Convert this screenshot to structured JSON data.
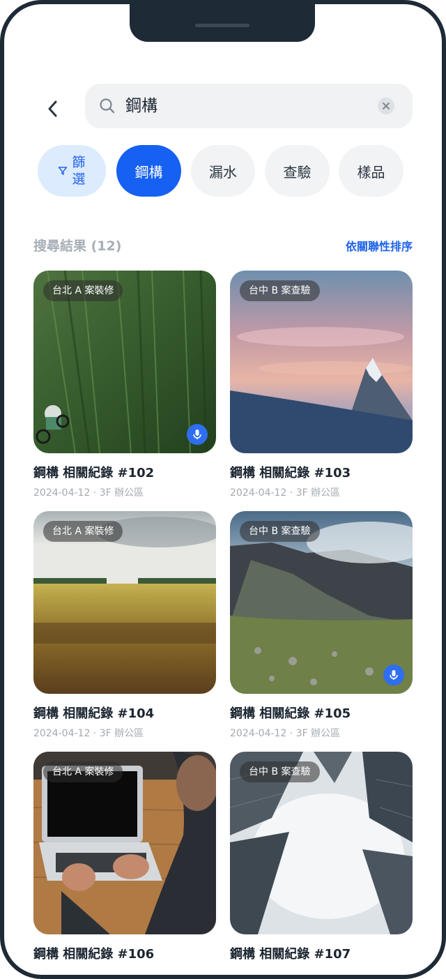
{
  "search": {
    "query": "鋼構",
    "placeholder": ""
  },
  "filters": {
    "filter_label": "篩選",
    "chips": [
      {
        "label": "鋼構",
        "active": true
      },
      {
        "label": "漏水",
        "active": false
      },
      {
        "label": "查驗",
        "active": false
      },
      {
        "label": "樣品",
        "active": false
      }
    ]
  },
  "results": {
    "title": "搜尋結果 (12)",
    "sort_label": "依關聯性排序",
    "items": [
      {
        "tag": "台北 A 案裝修",
        "title": "鋼構 相關紀錄 #102",
        "meta": "2024-04-12 · 3F 辦公區",
        "has_audio": true
      },
      {
        "tag": "台中 B 案查驗",
        "title": "鋼構 相關紀錄 #103",
        "meta": "2024-04-12 · 3F 辦公區",
        "has_audio": false
      },
      {
        "tag": "台北 A 案裝修",
        "title": "鋼構 相關紀錄 #104",
        "meta": "2024-04-12 · 3F 辦公區",
        "has_audio": false
      },
      {
        "tag": "台中 B 案查驗",
        "title": "鋼構 相關紀錄 #105",
        "meta": "2024-04-12 · 3F 辦公區",
        "has_audio": true
      },
      {
        "tag": "台北 A 案裝修",
        "title": "鋼構 相關紀錄 #106",
        "meta": "",
        "has_audio": false
      },
      {
        "tag": "台中 B 案查驗",
        "title": "鋼構 相關紀錄 #107",
        "meta": "",
        "has_audio": false
      }
    ]
  },
  "icons": {
    "back": "chevron-left-icon",
    "search": "search-icon",
    "clear": "close-icon",
    "filter": "filter-icon",
    "audio": "microphone-icon"
  },
  "colors": {
    "accent": "#1660f2",
    "filter_chip_bg": "#dcebfd",
    "chip_bg": "#f1f3f5",
    "frame": "#1e2a35"
  }
}
